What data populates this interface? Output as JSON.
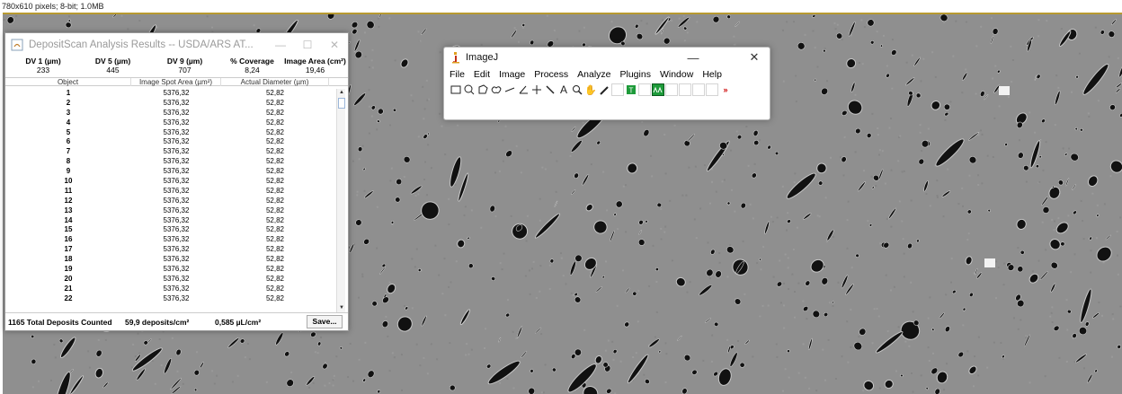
{
  "image_info": "780x610 pixels; 8-bit; 1.0MB",
  "depositscan": {
    "title": "DepositScan Analysis Results -- USDA/ARS AT...",
    "summary_headers": [
      "DV 1 (µm)",
      "DV 5 (µm)",
      "DV 9 (µm)",
      "% Coverage",
      "Image Area (cm²)"
    ],
    "summary_values": [
      "233",
      "445",
      "707",
      "8,24",
      "19,46"
    ],
    "table_headers": [
      "Object",
      "Image Spot Area (µm²)",
      "Actual Diameter (µm)"
    ],
    "rows": [
      [
        "1",
        "5376,32",
        "52,82"
      ],
      [
        "2",
        "5376,32",
        "52,82"
      ],
      [
        "3",
        "5376,32",
        "52,82"
      ],
      [
        "4",
        "5376,32",
        "52,82"
      ],
      [
        "5",
        "5376,32",
        "52,82"
      ],
      [
        "6",
        "5376,32",
        "52,82"
      ],
      [
        "7",
        "5376,32",
        "52,82"
      ],
      [
        "8",
        "5376,32",
        "52,82"
      ],
      [
        "9",
        "5376,32",
        "52,82"
      ],
      [
        "10",
        "5376,32",
        "52,82"
      ],
      [
        "11",
        "5376,32",
        "52,82"
      ],
      [
        "12",
        "5376,32",
        "52,82"
      ],
      [
        "13",
        "5376,32",
        "52,82"
      ],
      [
        "14",
        "5376,32",
        "52,82"
      ],
      [
        "15",
        "5376,32",
        "52,82"
      ],
      [
        "16",
        "5376,32",
        "52,82"
      ],
      [
        "17",
        "5376,32",
        "52,82"
      ],
      [
        "18",
        "5376,32",
        "52,82"
      ],
      [
        "19",
        "5376,32",
        "52,82"
      ],
      [
        "20",
        "5376,32",
        "52,82"
      ],
      [
        "21",
        "5376,32",
        "52,82"
      ],
      [
        "22",
        "5376,32",
        "52,82"
      ]
    ],
    "footer": {
      "total": "1165 Total Deposits Counted",
      "density": "59,9 deposits/cm²",
      "volume": "0,585 µL/cm²",
      "save_label": "Save..."
    }
  },
  "imagej": {
    "title": "ImageJ",
    "menus": [
      "File",
      "Edit",
      "Image",
      "Process",
      "Analyze",
      "Plugins",
      "Window",
      "Help"
    ],
    "tools": [
      "rectangle-tool",
      "oval-tool",
      "polygon-tool",
      "freehand-tool",
      "line-tool",
      "angle-tool",
      "point-tool",
      "wand-tool",
      "text-tool",
      "zoom-tool",
      "hand-tool",
      "color-picker-tool",
      "blank",
      "blank",
      "text-t-tool",
      "blank",
      "arrow-lut-tool",
      "blank",
      "blank",
      "blank",
      "more-tools"
    ],
    "accent": "#1e9b3a"
  }
}
